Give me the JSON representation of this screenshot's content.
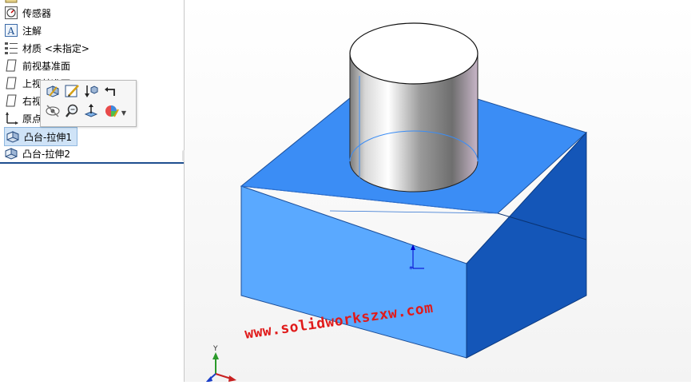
{
  "feature_tree": {
    "items": [
      {
        "name": "sensors",
        "label": "传感器",
        "icon": "sensor-icon"
      },
      {
        "name": "annotations",
        "label": "注解",
        "icon": "annotation-icon"
      },
      {
        "name": "material",
        "label": "材质 <未指定>",
        "icon": "material-icon"
      },
      {
        "name": "front-plane",
        "label": "前视基准面",
        "icon": "plane-icon"
      },
      {
        "name": "top-plane",
        "label": "上视基准面",
        "icon": "plane-icon"
      },
      {
        "name": "right-plane",
        "label": "右视基准面",
        "icon": "plane-icon"
      },
      {
        "name": "origin",
        "label": "原点",
        "icon": "origin-icon"
      },
      {
        "name": "boss-extrude-1",
        "label": "凸台-拉伸1",
        "icon": "extrude-icon",
        "selected": true
      },
      {
        "name": "boss-extrude-2",
        "label": "凸台-拉伸2",
        "icon": "extrude-icon"
      }
    ]
  },
  "context_toolbar": {
    "buttons": [
      "edit-feature-icon",
      "edit-sketch-icon",
      "rollback-icon",
      "parent-child-icon",
      "hide-icon",
      "zoom-to-selection-icon",
      "normal-to-icon",
      "appearance-icon"
    ]
  },
  "viewport": {
    "watermark": "www.solidworkszxw.com",
    "triad_label": "Y",
    "colors": {
      "block_front": "#5aa9ff",
      "block_right": "#1456b8",
      "block_top": "#3b8df5",
      "cylinder_top": "#ffffff",
      "watermark": "#e01a1a"
    }
  }
}
